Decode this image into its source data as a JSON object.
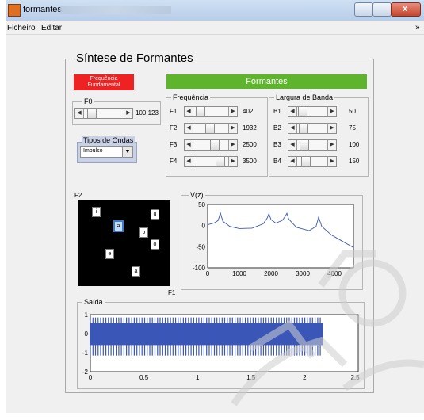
{
  "window": {
    "title": "formantes",
    "close_glyph": "x"
  },
  "menu": {
    "items": [
      "Ficheiro",
      "Editar"
    ],
    "overflow_glyph": "»"
  },
  "main": {
    "title": "Síntese de Formantes",
    "freq_fund_button": [
      "Frequência",
      "Fundamental"
    ],
    "formantes_button": "Formantes",
    "f0": {
      "label": "F0",
      "value": "100.123",
      "level": 0.12
    },
    "tipos": {
      "title": "Tipos de Ondas",
      "selected": "Impulso"
    },
    "frequencia": {
      "title": "Frequência",
      "rows": [
        {
          "label": "F1",
          "value": "402",
          "level": 0.1
        },
        {
          "label": "F2",
          "value": "1932",
          "level": 0.45
        },
        {
          "label": "F3",
          "value": "2500",
          "level": 0.6
        },
        {
          "label": "F4",
          "value": "3500",
          "level": 0.8
        }
      ]
    },
    "largura": {
      "title": "Largura de Banda",
      "rows": [
        {
          "label": "B1",
          "value": "50",
          "level": 0.08
        },
        {
          "label": "B2",
          "value": "75",
          "level": 0.1
        },
        {
          "label": "B3",
          "value": "100",
          "level": 0.12
        },
        {
          "label": "B4",
          "value": "150",
          "level": 0.2
        }
      ]
    },
    "f2f1": {
      "ylabel": "F2",
      "xlabel": "F1",
      "vowels": [
        "i",
        "u",
        "ə",
        "ɔ",
        "o",
        "e",
        "a"
      ],
      "selected": "ə"
    }
  },
  "chart_data": [
    {
      "type": "line",
      "title": "V(z)",
      "xlim": [
        0,
        4600
      ],
      "ylim": [
        -100,
        50
      ],
      "xticks": [
        "0",
        "1000",
        "2000",
        "3000",
        "4000"
      ],
      "yticks": [
        "50",
        "0",
        "-50",
        "-100"
      ],
      "x": [
        0,
        200,
        330,
        402,
        480,
        700,
        1000,
        1400,
        1750,
        1880,
        1932,
        2000,
        2150,
        2350,
        2450,
        2500,
        2560,
        2800,
        3200,
        3420,
        3500,
        3600,
        3900,
        4200,
        4600
      ],
      "y": [
        2,
        6,
        12,
        30,
        10,
        -2,
        -7,
        -6,
        4,
        18,
        28,
        14,
        6,
        12,
        22,
        29,
        15,
        -4,
        -12,
        -2,
        20,
        -2,
        -22,
        -35,
        -52
      ]
    },
    {
      "type": "area",
      "title": "Saída",
      "xlim": [
        0,
        2.5
      ],
      "ylim": [
        -2,
        1
      ],
      "xticks": [
        "0",
        "0.5",
        "1",
        "1.5",
        "2",
        "2.5"
      ],
      "yticks": [
        "1",
        "0",
        "-1",
        "-2"
      ],
      "signal": {
        "x_end": 2.17,
        "band_top": 0.55,
        "band_bottom": -0.6,
        "spike_top": 0.85,
        "spike_bottom": -1.15,
        "periods": 90
      }
    }
  ],
  "colors": {
    "plot_line": "#3a57b8",
    "freq_fund": "#ee2222",
    "formantes": "#5eb42c",
    "watermark": "#c9c9c9"
  }
}
